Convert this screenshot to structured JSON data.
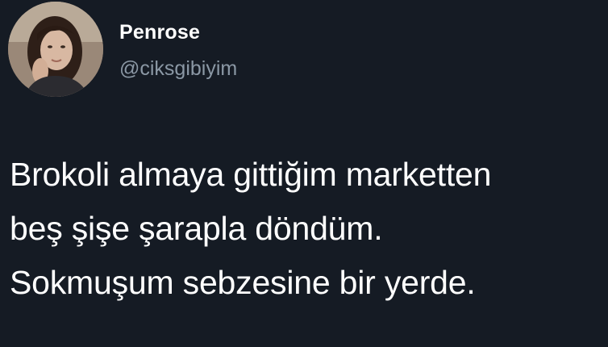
{
  "user": {
    "display_name": "Penrose",
    "handle": "@ciksgibiyim"
  },
  "tweet": {
    "lines": [
      "Brokoli almaya gittiğim marketten",
      "beş şişe şarapla döndüm.",
      "Sokmuşum sebzesine bir yerde."
    ]
  },
  "colors": {
    "background": "#151b24",
    "text": "#ffffff",
    "handle": "#8b98a5"
  }
}
